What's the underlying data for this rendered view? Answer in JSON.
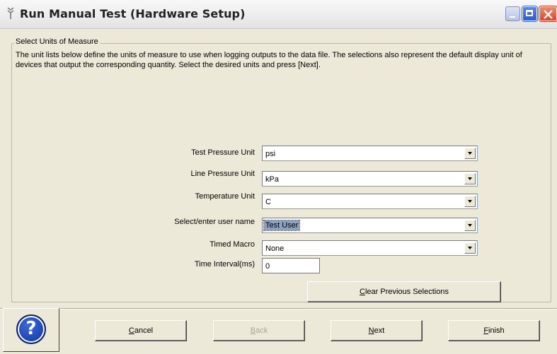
{
  "window": {
    "title": "Run Manual Test (Hardware Setup)"
  },
  "group": {
    "label": "Select Units of Measure",
    "description": "The unit lists below define the units of measure to use when logging outputs to the data file. The selections also represent the default display unit of devices that output the corresponding quantity.  Select the desired units and press [Next]."
  },
  "fields": {
    "test_pressure": {
      "label": "Test Pressure Unit",
      "value": "psi"
    },
    "line_pressure": {
      "label": "Line Pressure Unit",
      "value": "kPa"
    },
    "temperature": {
      "label": "Temperature Unit",
      "value": "C"
    },
    "user_name": {
      "label": "Select/enter user name",
      "value": "Test User"
    },
    "timed_macro": {
      "label": "Timed Macro",
      "value": "None"
    },
    "time_interval": {
      "label": "Time Interval(ms)",
      "value": "0"
    }
  },
  "buttons": {
    "clear": {
      "mnemonic": "C",
      "rest": "lear Previous Selections"
    },
    "cancel": {
      "mnemonic": "C",
      "rest": "ancel"
    },
    "back": {
      "mnemonic": "B",
      "rest": "ack"
    },
    "next": {
      "mnemonic": "N",
      "rest": "ext"
    },
    "finish": {
      "mnemonic": "F",
      "rest": "inish"
    }
  },
  "icons": {
    "help": "?"
  },
  "colors": {
    "dialog_bg": "#ece9d8",
    "selection": "#8aa2c0",
    "help_blue": "#0b2fa8"
  }
}
